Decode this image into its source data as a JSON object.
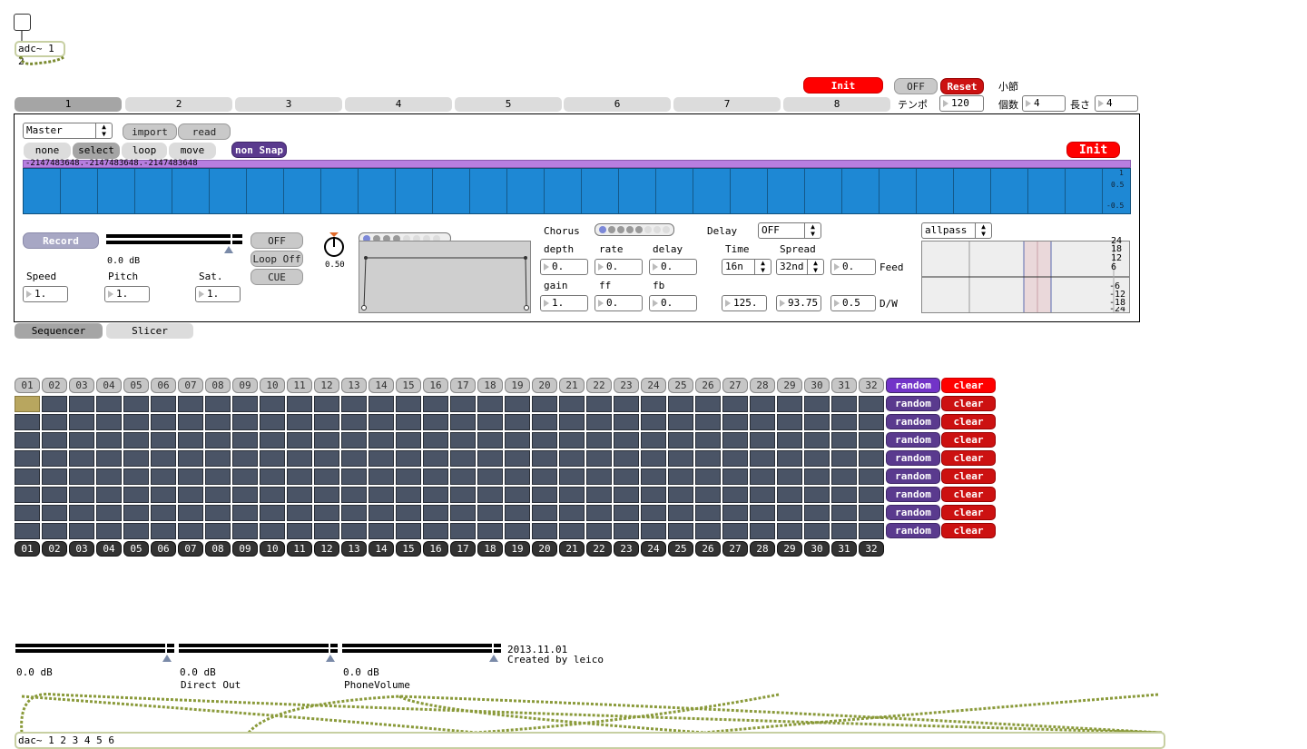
{
  "top": {
    "adc_label": "adc~ 1 2",
    "init_label": "Init",
    "off_label": "OFF",
    "reset_label": "Reset",
    "measure_label": "小節",
    "tempo_label": "テンポ",
    "tempo_value": "120",
    "count_label": "個数",
    "count_value": "4",
    "length_label": "長さ",
    "length_value": "4"
  },
  "tabs": [
    "1",
    "2",
    "3",
    "4",
    "5",
    "6",
    "7",
    "8"
  ],
  "panel": {
    "master_value": "Master",
    "import_label": "import",
    "read_label": "read",
    "modes": [
      "none",
      "select",
      "loop",
      "move"
    ],
    "snap_label": "non Snap",
    "init_label": "Init",
    "waveform_text": "-2147483648.-2147483648.-2147483648",
    "scale": [
      "1",
      "0.5",
      "-0.5"
    ],
    "record_label": "Record",
    "meter_db": "0.0 dB",
    "speed_label": "Speed",
    "speed_value": "1.",
    "pitch_label": "Pitch",
    "pitch_value": "1.",
    "sat_label": "Sat.",
    "sat_value": "1.",
    "play_off": "OFF",
    "loop_off": "Loop Off",
    "cue": "CUE",
    "dial_value": "0.50",
    "chorus_label": "Chorus",
    "depth_label": "depth",
    "depth_value": "0.",
    "rate_label": "rate",
    "rate_value": "0.",
    "cdelay_label": "delay",
    "cdelay_value": "0.",
    "gain_label": "gain",
    "gain_value": "1.",
    "ff_label": "ff",
    "ff_value": "0.",
    "fb_label": "fb",
    "fb_value": "0.",
    "delay_label": "Delay",
    "delay_value": "OFF",
    "time_label": "Time",
    "time_value": "16n",
    "spread_label": "Spread",
    "spread_value": "32nd",
    "feed_value": "0.",
    "feed_label": "Feed",
    "ms1_value": "125.",
    "ms2_value": "93.75",
    "dw_value": "0.5",
    "dw_label": "D/W",
    "filter_value": "allpass",
    "filter_scale": [
      "24",
      "18",
      "12",
      "6",
      "-6",
      "-12",
      "-18",
      "-24"
    ]
  },
  "subtabs": [
    "Sequencer",
    "Slicer"
  ],
  "sequencer": {
    "steps": [
      "01",
      "02",
      "03",
      "04",
      "05",
      "06",
      "07",
      "08",
      "09",
      "10",
      "11",
      "12",
      "13",
      "14",
      "15",
      "16",
      "17",
      "18",
      "19",
      "20",
      "21",
      "22",
      "23",
      "24",
      "25",
      "26",
      "27",
      "28",
      "29",
      "30",
      "31",
      "32"
    ],
    "random_label": "random",
    "clear_label": "clear",
    "rows": 8
  },
  "bottom": {
    "meter1_db": "0.0 dB",
    "meter2_db": "0.0 dB",
    "meter2_label": "Direct Out",
    "meter3_db": "0.0 dB",
    "meter3_label": "PhoneVolume",
    "date": "2013.11.01",
    "credit": "Created by leico",
    "dac_label": "dac~ 1 2 3 4 5 6"
  }
}
